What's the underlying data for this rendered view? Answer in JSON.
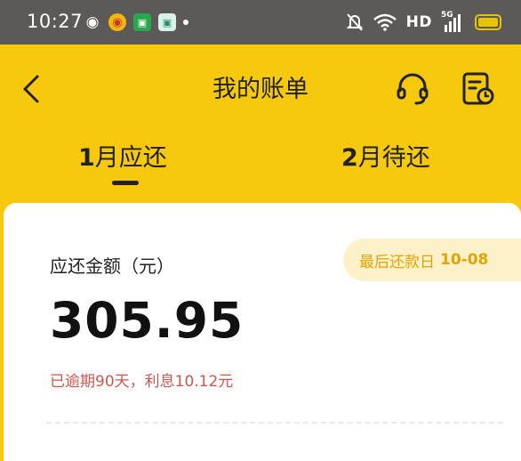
{
  "status_bar": {
    "time": "10:27",
    "network": "HD",
    "network_gen": "5G",
    "icons": [
      "wechat-icon",
      "weibo-icon",
      "green-app-icon",
      "mint-app-icon",
      "notification-dot",
      "mute-bell-icon",
      "wifi-icon",
      "signal-icon",
      "battery-icon"
    ]
  },
  "header": {
    "title": "我的账单",
    "icons": [
      "back-chevron-icon",
      "customer-service-headset-icon",
      "bill-record-icon"
    ]
  },
  "tabs": [
    {
      "num": "1",
      "label": "月应还",
      "active": true
    },
    {
      "num": "2",
      "label": "月待还",
      "active": false
    }
  ],
  "bill": {
    "due_label": "应还金额（元）",
    "last_repay_label": "最后还款日",
    "last_repay_date": "10-08",
    "amount": "305.95",
    "overdue_text": "已逾期90天，利息10.12元"
  },
  "colors": {
    "brand_yellow": "#f6c90e",
    "status_bar": "#5c5a58",
    "badge_bg": "#fcf1c9",
    "badge_text": "#e3a400",
    "overdue_red": "#c9574f"
  }
}
